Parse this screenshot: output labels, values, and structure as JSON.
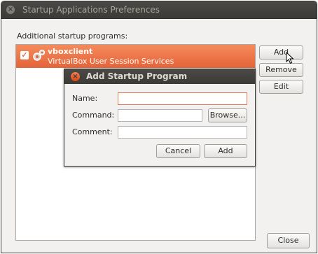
{
  "window": {
    "title": "Startup Applications Preferences",
    "close_glyph": "×"
  },
  "list": {
    "label": "Additional startup programs:",
    "items": [
      {
        "name": "vboxclient",
        "description": "VirtualBox User Session Services",
        "checked": true,
        "icon": "gear-icon"
      }
    ]
  },
  "side_buttons": {
    "add": "Add",
    "remove": "Remove",
    "edit": "Edit"
  },
  "footer": {
    "close": "Close"
  },
  "dialog": {
    "title": "Add Startup Program",
    "close_glyph": "×",
    "name_label": "Name:",
    "name_value": "",
    "command_label": "Command:",
    "command_value": "",
    "browse": "Browse...",
    "comment_label": "Comment:",
    "comment_value": "",
    "cancel": "Cancel",
    "add": "Add"
  },
  "colors": {
    "selection": "#e4643a",
    "titlebar": "#3c3b37",
    "dialog_close": "#dd4814"
  }
}
